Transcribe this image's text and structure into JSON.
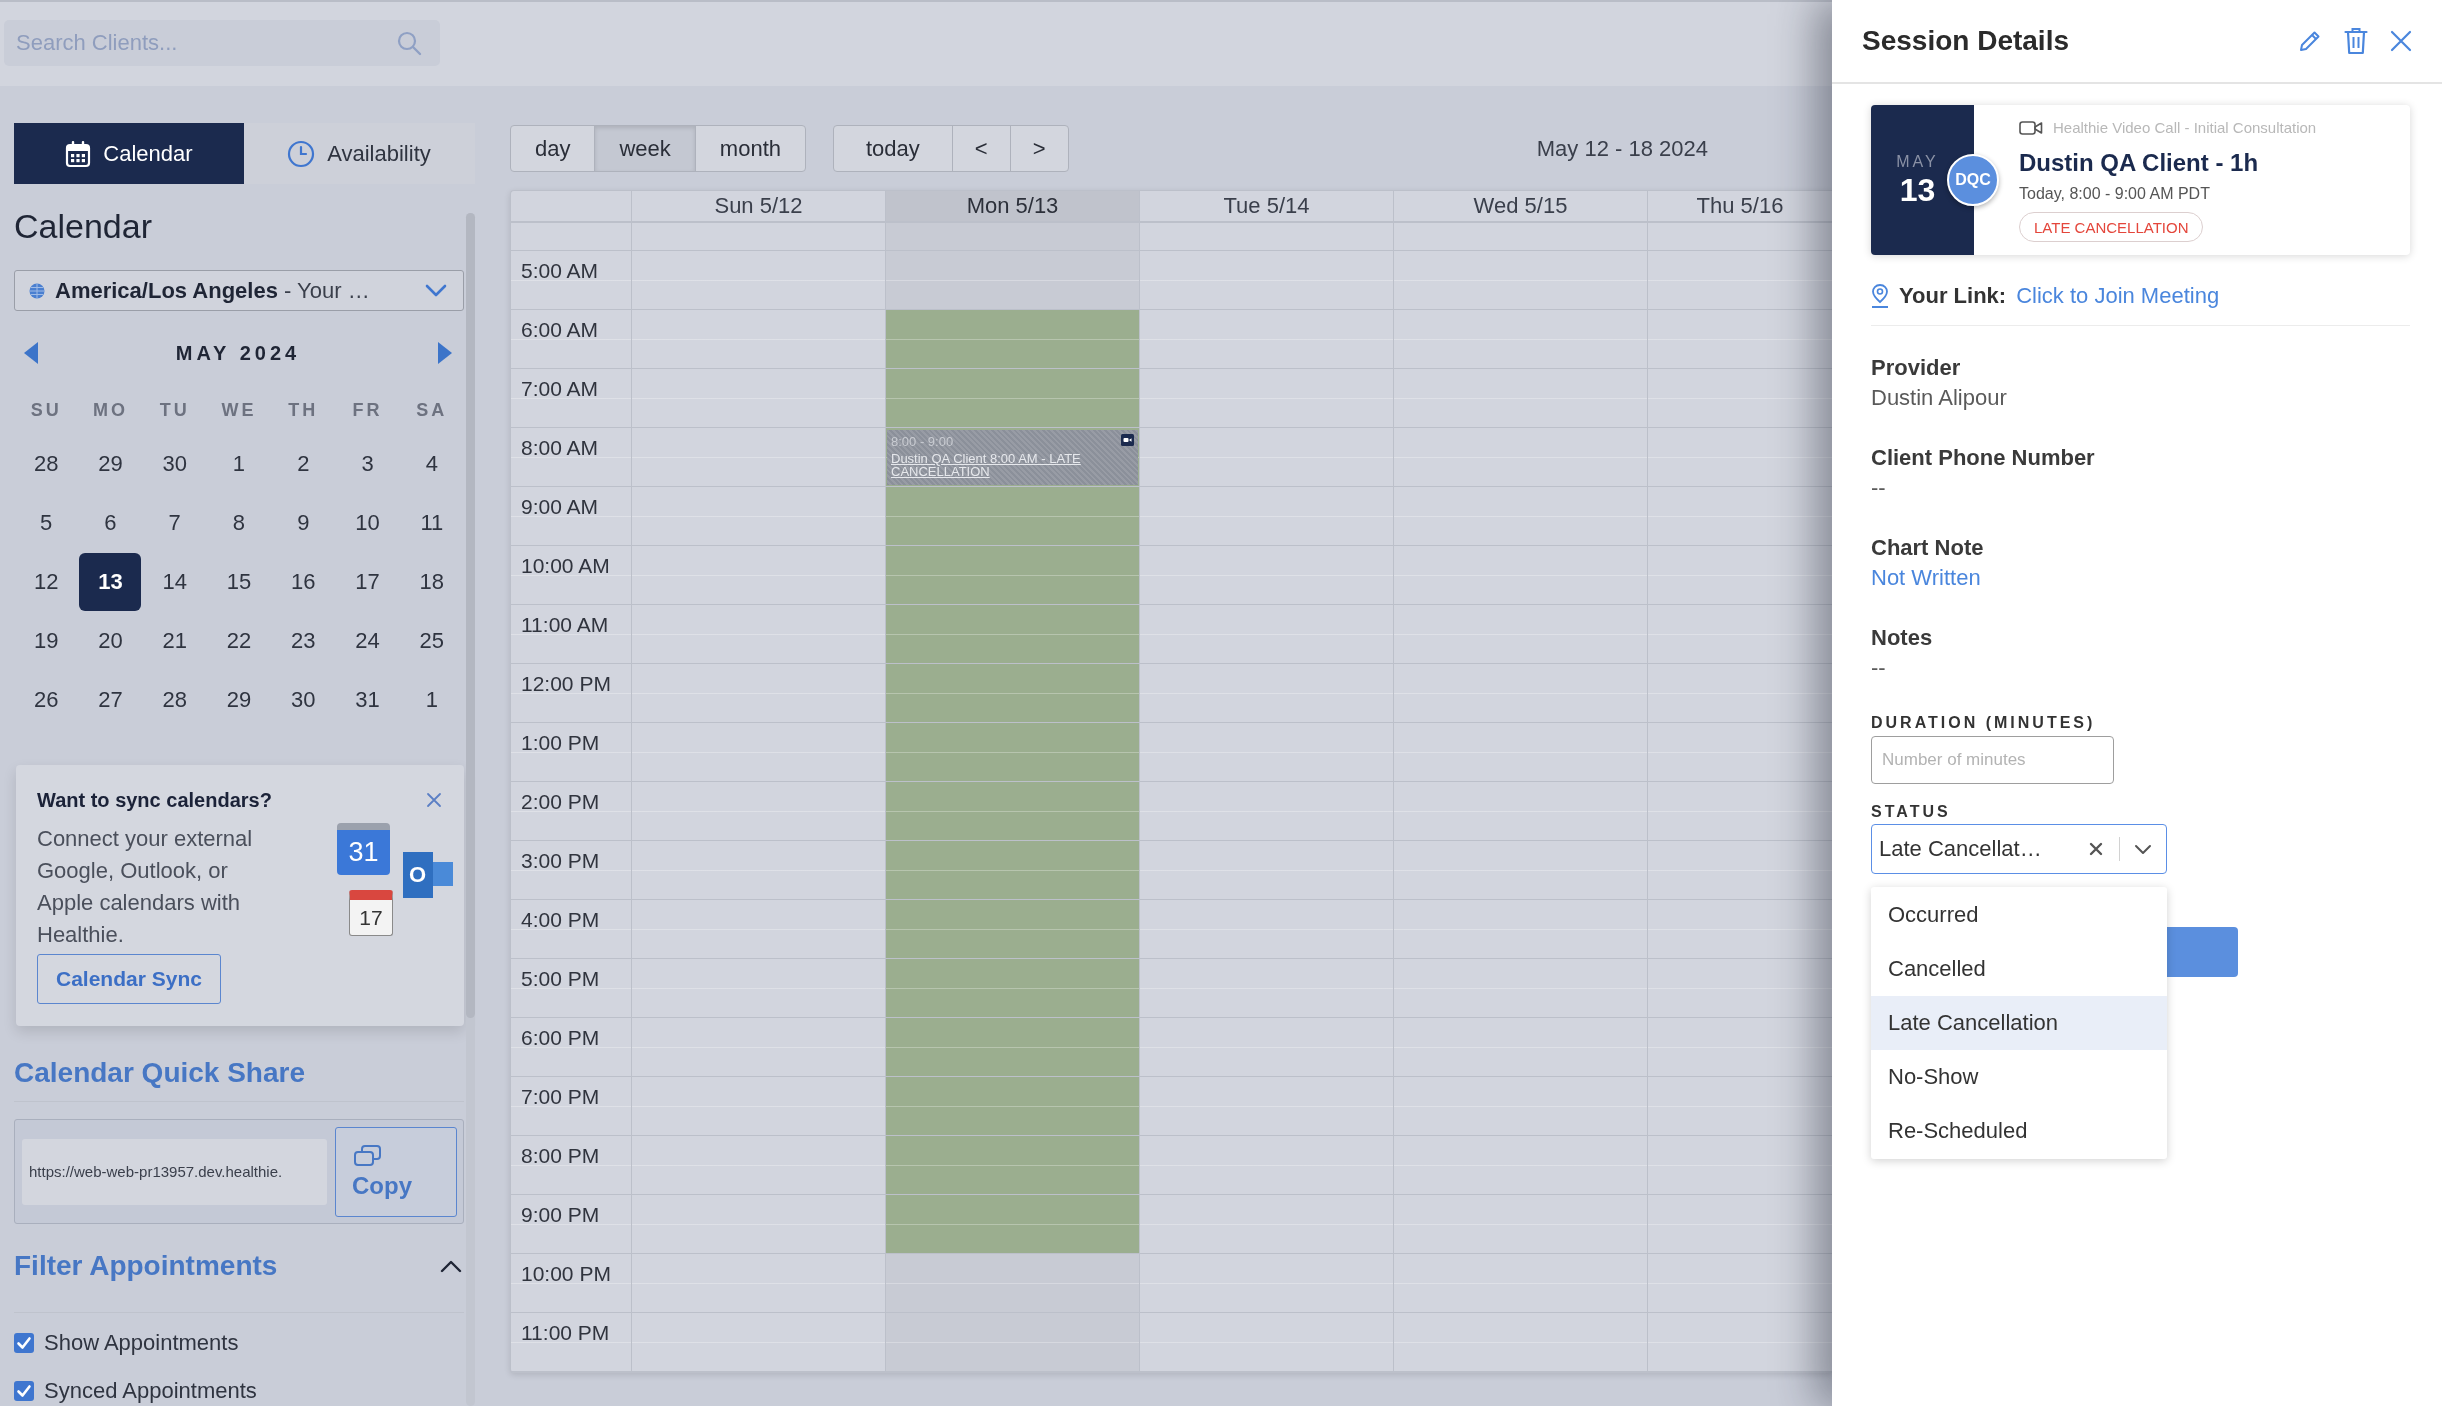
{
  "search": {
    "placeholder": "Search Clients..."
  },
  "sidebar": {
    "tabs": [
      {
        "label": "Calendar",
        "selected": true
      },
      {
        "label": "Availability",
        "selected": false
      }
    ],
    "heading": "Calendar",
    "timezone": "**America/Los Angeles** - Your …",
    "mini_calendar": {
      "month": "MAY 2024",
      "weekdays": [
        "SU",
        "MO",
        "TU",
        "WE",
        "TH",
        "FR",
        "SA"
      ],
      "weeks": [
        [
          {
            "day": "28",
            "selected": false
          },
          {
            "day": "29",
            "selected": false
          },
          {
            "day": "30",
            "selected": false
          },
          {
            "day": "1",
            "selected": false
          },
          {
            "day": "2",
            "selected": false
          },
          {
            "day": "3",
            "selected": false
          },
          {
            "day": "4",
            "selected": false
          }
        ],
        [
          {
            "day": "5",
            "selected": false
          },
          {
            "day": "6",
            "selected": false
          },
          {
            "day": "7",
            "selected": false
          },
          {
            "day": "8",
            "selected": false
          },
          {
            "day": "9",
            "selected": false
          },
          {
            "day": "10",
            "selected": false
          },
          {
            "day": "11",
            "selected": false
          }
        ],
        [
          {
            "day": "12",
            "selected": false
          },
          {
            "day": "13",
            "selected": true
          },
          {
            "day": "14",
            "selected": false
          },
          {
            "day": "15",
            "selected": false
          },
          {
            "day": "16",
            "selected": false
          },
          {
            "day": "17",
            "selected": false
          },
          {
            "day": "18",
            "selected": false
          }
        ],
        [
          {
            "day": "19",
            "selected": false
          },
          {
            "day": "20",
            "selected": false
          },
          {
            "day": "21",
            "selected": false
          },
          {
            "day": "22",
            "selected": false
          },
          {
            "day": "23",
            "selected": false
          },
          {
            "day": "24",
            "selected": false
          },
          {
            "day": "25",
            "selected": false
          }
        ],
        [
          {
            "day": "26",
            "selected": false
          },
          {
            "day": "27",
            "selected": false
          },
          {
            "day": "28",
            "selected": false
          },
          {
            "day": "29",
            "selected": false
          },
          {
            "day": "30",
            "selected": false
          },
          {
            "day": "31",
            "selected": false
          },
          {
            "day": "1",
            "selected": false
          }
        ]
      ]
    },
    "sync_card": {
      "title": "Want to sync calendars?",
      "body": "Connect your external Google, Outlook, or Apple calendars with Healthie.",
      "button": "Calendar Sync",
      "logos": [
        {
          "kind": "tile",
          "text": "31"
        },
        {
          "kind": "mail",
          "text": "O"
        },
        {
          "kind": "page",
          "text": "17"
        }
      ]
    },
    "quick_share": {
      "heading": "Calendar Quick Share",
      "url": "https://web-web-pr13957.dev.healthie.",
      "button": "Copy"
    },
    "filter": {
      "heading": "Filter Appointments",
      "expanded": true,
      "items": [
        {
          "label": "Show Appointments",
          "checked": true
        },
        {
          "label": "Synced Appointments",
          "checked": true
        }
      ]
    }
  },
  "calendar": {
    "views": [
      {
        "label": "day",
        "selected": false
      },
      {
        "label": "week",
        "selected": true
      },
      {
        "label": "month",
        "selected": false
      }
    ],
    "nav": [
      "today",
      "<",
      ">"
    ],
    "range": "May 12 - 18 2024",
    "hours": [
      "5:00 AM",
      "6:00 AM",
      "7:00 AM",
      "8:00 AM",
      "9:00 AM",
      "10:00 AM",
      "11:00 AM",
      "12:00 PM",
      "1:00 PM",
      "2:00 PM",
      "3:00 PM",
      "4:00 PM",
      "5:00 PM",
      "6:00 PM",
      "7:00 PM",
      "8:00 PM",
      "9:00 PM",
      "10:00 PM",
      "11:00 PM"
    ],
    "days": [
      {
        "label": "Sun 5/12",
        "today": false,
        "slots": [
          {
            "available": false
          },
          {
            "available": false
          },
          {
            "available": false
          },
          {
            "available": false
          },
          {
            "available": false
          },
          {
            "available": false
          },
          {
            "available": false
          },
          {
            "available": false
          },
          {
            "available": false
          },
          {
            "available": false
          },
          {
            "available": false
          },
          {
            "available": false
          },
          {
            "available": false
          },
          {
            "available": false
          },
          {
            "available": false
          },
          {
            "available": false
          },
          {
            "available": false
          },
          {
            "available": false
          },
          {
            "available": false
          }
        ]
      },
      {
        "label": "Mon 5/13",
        "today": true,
        "slots": [
          {
            "available": false
          },
          {
            "available": true
          },
          {
            "available": true
          },
          {
            "available": true,
            "event": {
              "time": "8:00 - 9:00",
              "title": "Dustin QA Client 8:00 AM - LATE CANCELLATION"
            }
          },
          {
            "available": true
          },
          {
            "available": true
          },
          {
            "available": true
          },
          {
            "available": true
          },
          {
            "available": true
          },
          {
            "available": true
          },
          {
            "available": true
          },
          {
            "available": true
          },
          {
            "available": true
          },
          {
            "available": true
          },
          {
            "available": true
          },
          {
            "available": true
          },
          {
            "available": true
          },
          {
            "available": false
          },
          {
            "available": false
          }
        ]
      },
      {
        "label": "Tue 5/14",
        "today": false,
        "slots": [
          {
            "available": false
          },
          {
            "available": false
          },
          {
            "available": false
          },
          {
            "available": false
          },
          {
            "available": false
          },
          {
            "available": false
          },
          {
            "available": false
          },
          {
            "available": false
          },
          {
            "available": false
          },
          {
            "available": false
          },
          {
            "available": false
          },
          {
            "available": false
          },
          {
            "available": false
          },
          {
            "available": false
          },
          {
            "available": false
          },
          {
            "available": false
          },
          {
            "available": false
          },
          {
            "available": false
          },
          {
            "available": false
          }
        ]
      },
      {
        "label": "Wed 5/15",
        "today": false,
        "slots": [
          {
            "available": false
          },
          {
            "available": false
          },
          {
            "available": false
          },
          {
            "available": false
          },
          {
            "available": false
          },
          {
            "available": false
          },
          {
            "available": false
          },
          {
            "available": false
          },
          {
            "available": false
          },
          {
            "available": false
          },
          {
            "available": false
          },
          {
            "available": false
          },
          {
            "available": false
          },
          {
            "available": false
          },
          {
            "available": false
          },
          {
            "available": false
          },
          {
            "available": false
          },
          {
            "available": false
          },
          {
            "available": false
          }
        ]
      },
      {
        "label": "Thu 5/16",
        "today": false,
        "slots": [
          {
            "available": false
          },
          {
            "available": false
          },
          {
            "available": false
          },
          {
            "available": false
          },
          {
            "available": false
          },
          {
            "available": false
          },
          {
            "available": false
          },
          {
            "available": false
          },
          {
            "available": false
          },
          {
            "available": false
          },
          {
            "available": false
          },
          {
            "available": false
          },
          {
            "available": false
          },
          {
            "available": false
          },
          {
            "available": false
          },
          {
            "available": false
          },
          {
            "available": false
          },
          {
            "available": false
          },
          {
            "available": false
          }
        ]
      }
    ]
  },
  "session": {
    "title": "Session Details",
    "card": {
      "month": "MAY",
      "day": "13",
      "avatar": "DQC",
      "type": "Healthie Video Call - Initial Consultation",
      "title": "Dustin QA Client - 1h",
      "time": "Today, 8:00 - 9:00 AM PDT",
      "badge": "LATE CANCELLATION"
    },
    "link": {
      "label": "Your Link:",
      "text": "Click to Join Meeting"
    },
    "fields": [
      {
        "kind": "text",
        "label": "Provider",
        "value": "Dustin Alipour"
      },
      {
        "kind": "text",
        "label": "Client Phone Number",
        "value": "--"
      },
      {
        "kind": "link",
        "label": "Chart Note",
        "value": "Not Written"
      },
      {
        "kind": "text",
        "label": "Notes",
        "value": "--"
      }
    ],
    "duration": {
      "label": "DURATION (MINUTES)",
      "placeholder": "Number of minutes"
    },
    "status": {
      "label": "STATUS",
      "value": "Late Cancellat…",
      "open": true,
      "options": [
        {
          "label": "Occurred",
          "selected": false
        },
        {
          "label": "Cancelled",
          "selected": false
        },
        {
          "label": "Late Cancellation",
          "selected": true
        },
        {
          "label": "No-Show",
          "selected": false
        },
        {
          "label": "Re-Scheduled",
          "selected": false
        }
      ]
    }
  }
}
